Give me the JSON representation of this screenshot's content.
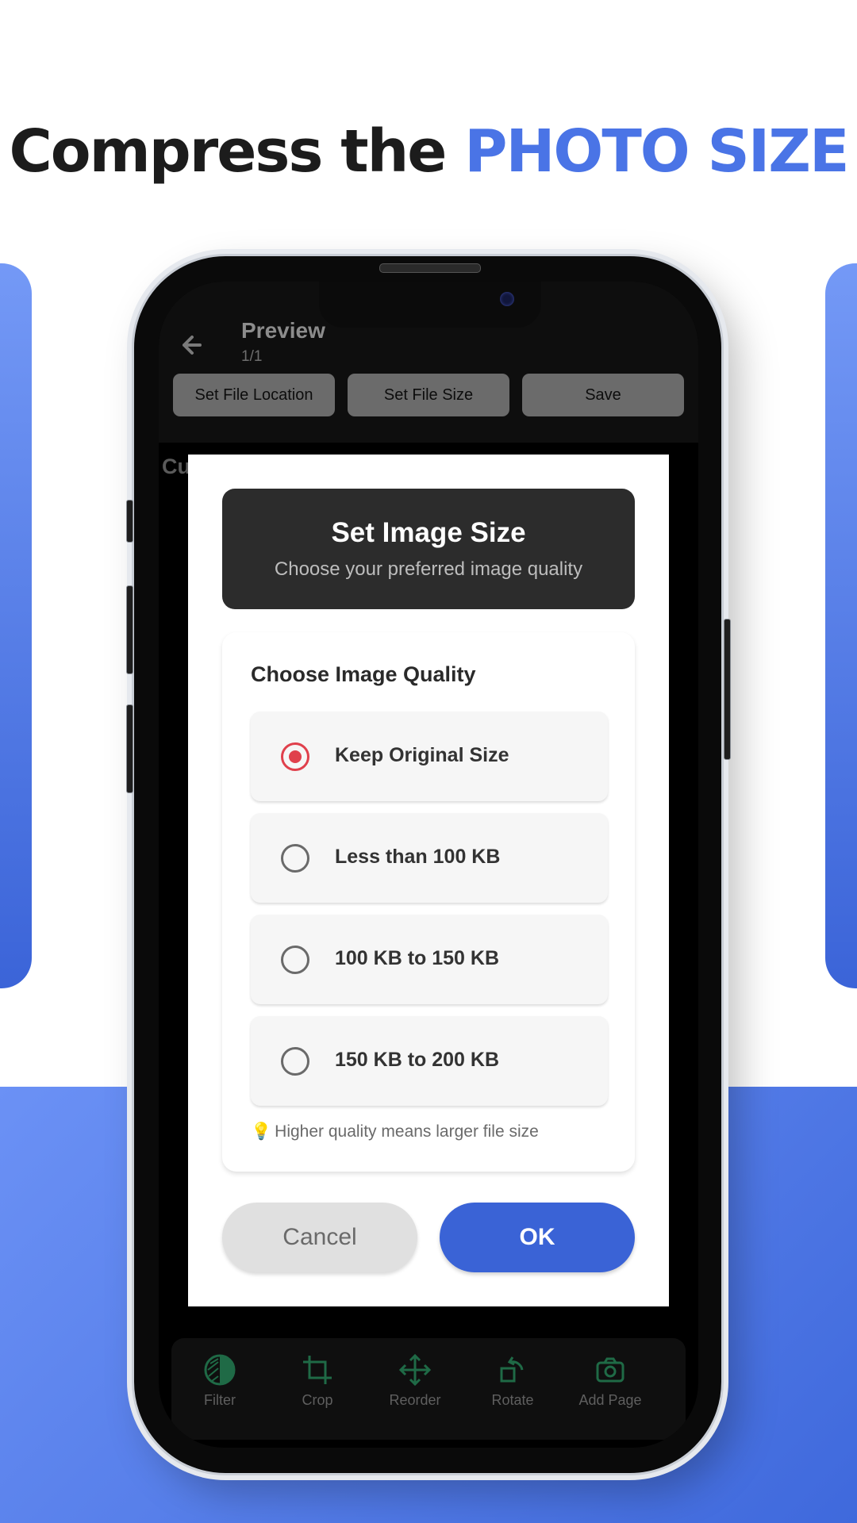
{
  "headline": {
    "text": "Compress the",
    "accent": "PHOTO SIZE"
  },
  "colors": {
    "accent": "#4a74e6",
    "ok_button": "#3a63d6",
    "radio_selected": "#e0404c",
    "tool_icon": "#1f6a46"
  },
  "appbar": {
    "title": "Preview",
    "page_indicator": "1/1",
    "buttons": [
      "Set File Location",
      "Set File Size",
      "Save"
    ]
  },
  "behind_text": "Cu",
  "dialog": {
    "title": "Set Image Size",
    "subtitle": "Choose your preferred image quality",
    "section_label": "Choose Image Quality",
    "options": [
      {
        "label": "Keep Original Size",
        "selected": true
      },
      {
        "label": "Less than 100 KB",
        "selected": false
      },
      {
        "label": "100 KB to 150 KB",
        "selected": false
      },
      {
        "label": "150 KB to 200 KB",
        "selected": false
      }
    ],
    "hint_icon": "lightbulb-icon",
    "hint": "Higher quality means larger file size",
    "cancel": "Cancel",
    "ok": "OK"
  },
  "toolbar": [
    {
      "label": "Filter",
      "icon": "filter-icon"
    },
    {
      "label": "Crop",
      "icon": "crop-icon"
    },
    {
      "label": "Reorder",
      "icon": "move-icon"
    },
    {
      "label": "Rotate",
      "icon": "rotate-icon"
    },
    {
      "label": "Add Page",
      "icon": "camera-icon"
    }
  ]
}
